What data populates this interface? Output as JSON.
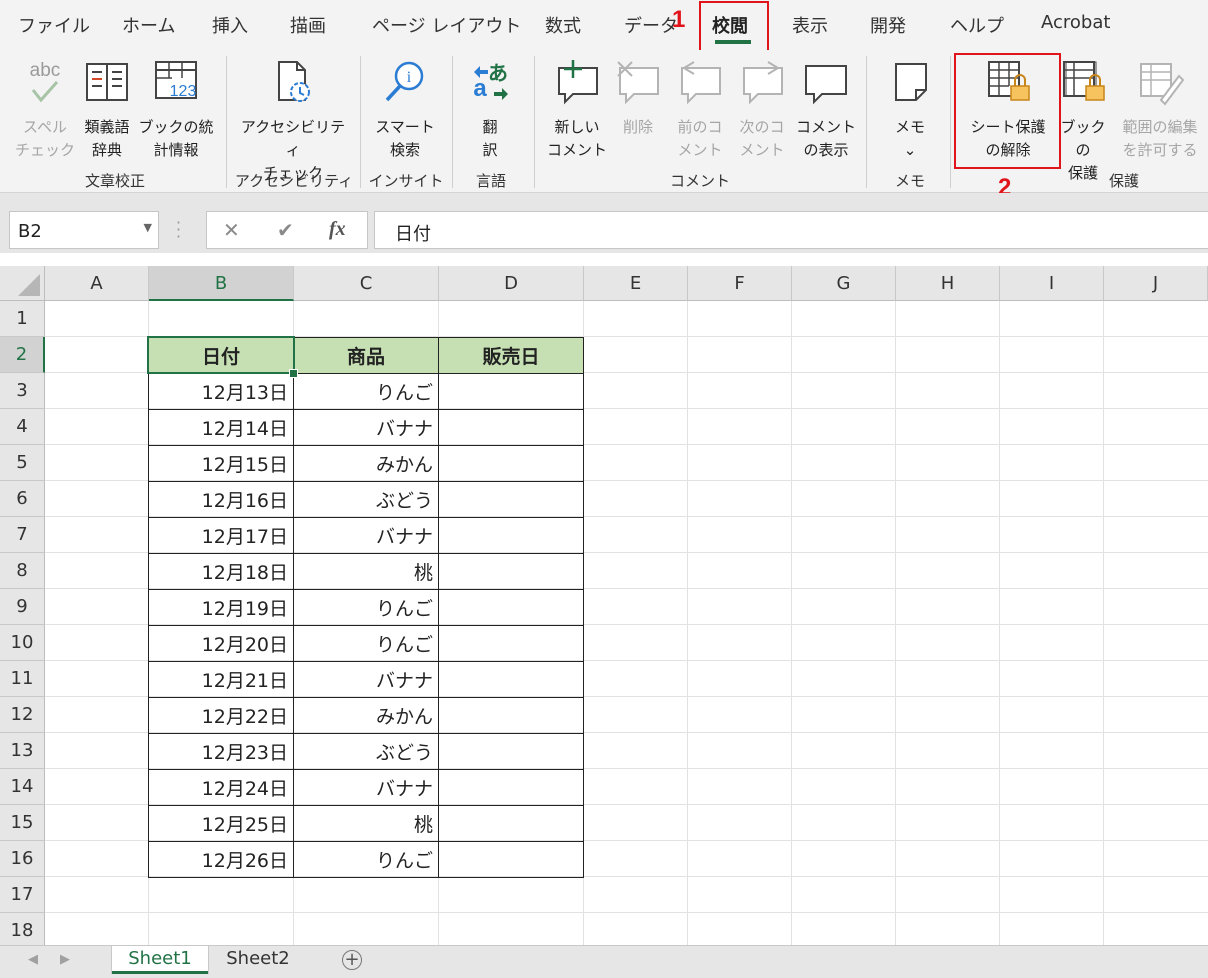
{
  "ribbon_tabs": [
    "ファイル",
    "ホーム",
    "挿入",
    "描画",
    "ページ レイアウト",
    "数式",
    "データ",
    "校閲",
    "表示",
    "開発",
    "ヘルプ",
    "Acrobat"
  ],
  "callouts": {
    "one": "1",
    "two": "2"
  },
  "ribbon": {
    "spell": {
      "icon_text": "abc",
      "line1": "スペル",
      "line2": "チェック"
    },
    "thesaurus": {
      "line1": "類義語",
      "line2": "辞典"
    },
    "stats": {
      "icon_text": "123",
      "line1": "ブックの統",
      "line2": "計情報"
    },
    "access": {
      "line1": "アクセシビリティ",
      "line2": "チェック"
    },
    "smart": {
      "line1": "スマート",
      "line2": "検索"
    },
    "translate": {
      "line1": "翻",
      "line2": "訳"
    },
    "new_comment": {
      "line1": "新しい",
      "line2": "コメント"
    },
    "delete": {
      "line1": "削除"
    },
    "prev": {
      "line1": "前のコ",
      "line2": "メント"
    },
    "next": {
      "line1": "次のコ",
      "line2": "メント"
    },
    "show": {
      "line1": "コメント",
      "line2": "の表示"
    },
    "memo": {
      "line1": "メモ",
      "line2": "⌄"
    },
    "unprotect": {
      "line1": "シート保護",
      "line2": "の解除"
    },
    "protect_book": {
      "line1": "ブックの",
      "line2": "保護"
    },
    "allow_edit": {
      "line1": "範囲の編集",
      "line2": "を許可する"
    },
    "groups": {
      "proofing": "文章校正",
      "accessibility": "アクセシビリティ",
      "insights": "インサイト",
      "language": "言語",
      "comments": "コメント",
      "notes": "メモ",
      "protect": "保護"
    }
  },
  "formula_bar": {
    "name_box": "B2",
    "cancel": "✕",
    "enter": "✔",
    "fx": "fx",
    "formula": "日付"
  },
  "columns": [
    "A",
    "B",
    "C",
    "D",
    "E",
    "F",
    "G",
    "H",
    "I",
    "J"
  ],
  "rows": [
    "1",
    "2",
    "3",
    "4",
    "5",
    "6",
    "7",
    "8",
    "9",
    "10",
    "11",
    "12",
    "13",
    "14",
    "15",
    "16",
    "17",
    "18"
  ],
  "table": {
    "headers": [
      "日付",
      "商品",
      "販売日"
    ],
    "rows": [
      [
        "12月13日",
        "りんご",
        ""
      ],
      [
        "12月14日",
        "バナナ",
        ""
      ],
      [
        "12月15日",
        "みかん",
        ""
      ],
      [
        "12月16日",
        "ぶどう",
        ""
      ],
      [
        "12月17日",
        "バナナ",
        ""
      ],
      [
        "12月18日",
        "桃",
        ""
      ],
      [
        "12月19日",
        "りんご",
        ""
      ],
      [
        "12月20日",
        "りんご",
        ""
      ],
      [
        "12月21日",
        "バナナ",
        ""
      ],
      [
        "12月22日",
        "みかん",
        ""
      ],
      [
        "12月23日",
        "ぶどう",
        ""
      ],
      [
        "12月24日",
        "バナナ",
        ""
      ],
      [
        "12月25日",
        "桃",
        ""
      ],
      [
        "12月26日",
        "りんご",
        ""
      ]
    ]
  },
  "sheets": [
    "Sheet1",
    "Sheet2"
  ],
  "add_sheet": "+",
  "colors": {
    "accent": "#217346",
    "highlight": "#e0141b",
    "header_fill": "#c6e0b4"
  }
}
